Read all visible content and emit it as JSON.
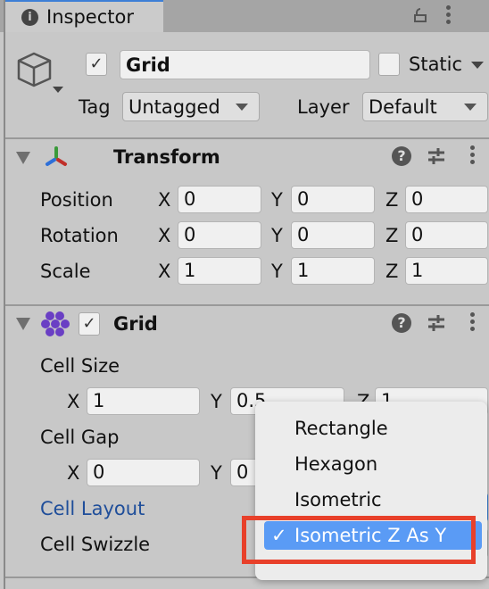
{
  "tab": {
    "title": "Inspector",
    "icon": "info-icon"
  },
  "object": {
    "active": true,
    "name": "Grid",
    "static_label": "Static",
    "static": false,
    "tag_label": "Tag",
    "tag_value": "Untagged",
    "layer_label": "Layer",
    "layer_value": "Default"
  },
  "transform": {
    "title": "Transform",
    "rows": [
      {
        "label": "Position",
        "x": "0",
        "y": "0",
        "z": "0"
      },
      {
        "label": "Rotation",
        "x": "0",
        "y": "0",
        "z": "0"
      },
      {
        "label": "Scale",
        "x": "1",
        "y": "1",
        "z": "1"
      }
    ]
  },
  "axes": {
    "x": "X",
    "y": "Y",
    "z": "Z"
  },
  "grid": {
    "title": "Grid",
    "enabled": true,
    "cell_size_label": "Cell Size",
    "cell_size": {
      "x": "1",
      "y": "0.5",
      "z": "1"
    },
    "cell_gap_label": "Cell Gap",
    "cell_gap": {
      "x": "0",
      "y": "0"
    },
    "cell_layout_label": "Cell Layout",
    "cell_swizzle_label": "Cell Swizzle"
  },
  "menu": {
    "items": [
      "Rectangle",
      "Hexagon",
      "Isometric",
      "Isometric Z As Y"
    ],
    "selected": "Isometric Z As Y",
    "check": "✓"
  },
  "colors": {
    "selection": "#5a9bf5",
    "highlight_box": "#e8402a",
    "modified_label": "#1f4e9a"
  }
}
